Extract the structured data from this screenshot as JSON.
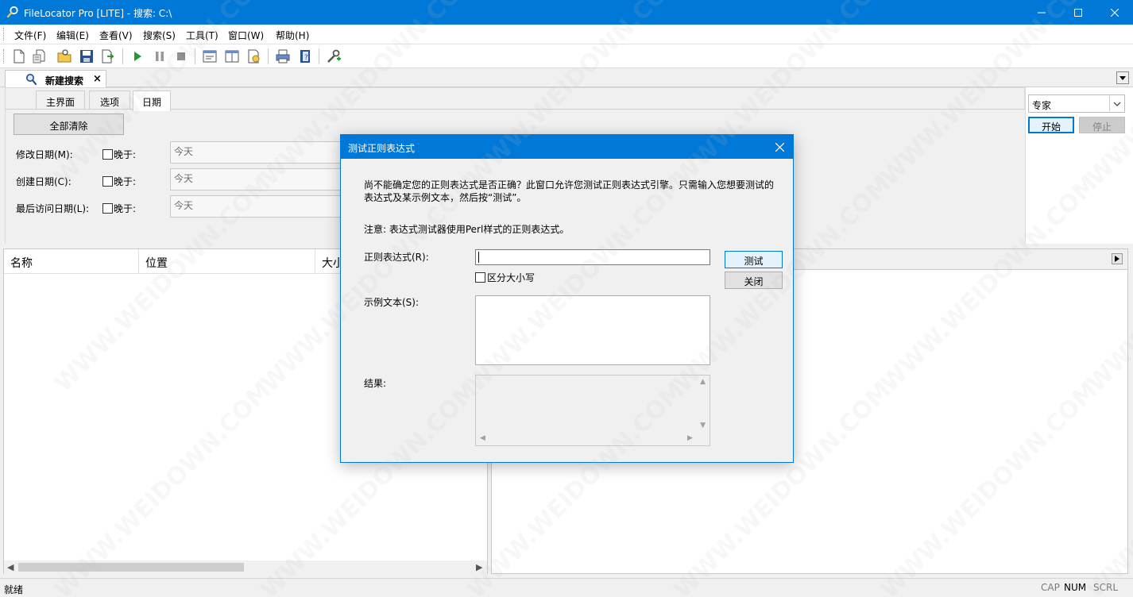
{
  "window": {
    "title": "FileLocator Pro [LITE] - 搜索: C:\\",
    "icons": [
      "search-icon",
      "minimize-icon",
      "maximize-icon",
      "close-icon"
    ]
  },
  "menu": [
    "文件(F)",
    "编辑(E)",
    "查看(V)",
    "搜索(S)",
    "工具(T)",
    "窗口(W)",
    "帮助(H)"
  ],
  "toolbar": {
    "buttons": [
      "new-icon",
      "open-icon",
      "open-folder-icon",
      "save-icon",
      "export-icon",
      "start-icon",
      "pause-icon",
      "stop-icon",
      "view-icon",
      "layout-icon",
      "options-icon",
      "print-icon",
      "book-icon",
      "tools-icon"
    ]
  },
  "doc_tab": {
    "label": "新建搜索",
    "close": "×"
  },
  "criteria": {
    "tabs": [
      "主界面",
      "选项",
      "日期"
    ],
    "active_tab": "日期",
    "clear_all": "全部清除",
    "rows": [
      {
        "label": "修改日期(M):",
        "check": "晚于:",
        "value": "今天"
      },
      {
        "label": "创建日期(C):",
        "check": "晚于:",
        "value": "今天"
      },
      {
        "label": "最后访问日期(L):",
        "check": "晚于:",
        "value": "今天"
      }
    ]
  },
  "search_panel": {
    "mode": "专家",
    "start": "开始",
    "stop": "停止"
  },
  "results": {
    "columns": [
      "名称",
      "位置",
      "大小"
    ]
  },
  "status": {
    "ready": "就绪",
    "indicators": [
      "CAP",
      "NUM",
      "SCRL"
    ],
    "active": "NUM"
  },
  "watermark": "WWW.WEIDOWN.COM",
  "dialog": {
    "title": "测试正则表达式",
    "intro_line1": "尚不能确定您的正则表达式是否正确？此窗口允许您测试正则表达式引擎。只需输入您想要测试的",
    "intro_line2": "表达式及某示例文本，然后按“测试”。",
    "note": "注意: 表达式测试器使用Perl样式的正则表达式。",
    "regex_label": "正则表达式(R):",
    "regex_value": "",
    "case_label": "区分大小写",
    "sample_label": "示例文本(S):",
    "sample_value": "",
    "result_label": "结果:",
    "result_value": "",
    "test_button": "测试",
    "close_button": "关闭"
  }
}
